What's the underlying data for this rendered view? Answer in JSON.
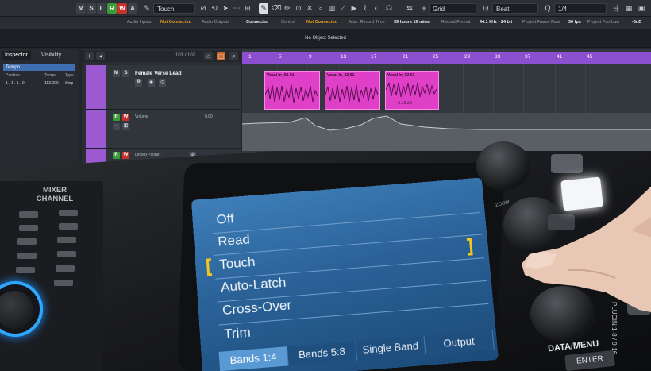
{
  "toolbar": {
    "buttons": [
      "M",
      "S",
      "L",
      "R",
      "W",
      "A"
    ],
    "automation_mode": "Touch",
    "snap_type": "Grid",
    "grid_type": "Beat",
    "quantize": "1/4"
  },
  "infobar": {
    "audio_inputs_label": "Audio Inputs",
    "audio_inputs_value": "Not Connected",
    "audio_outputs_label": "Audio Outputs",
    "audio_outputs_value": "Connected",
    "control_label": "Control",
    "control_value": "Not Connected",
    "max_record_label": "Max. Record Time",
    "max_record_value": "39 hours 16 mins",
    "record_format_label": "Record Format",
    "record_format_value": "44.1 kHz - 24 bit",
    "frame_rate_label": "Project Frame Rate",
    "frame_rate_value": "30 fps",
    "pan_law_label": "Project Pan Law",
    "pan_law_value": "-3dB"
  },
  "status": {
    "text": "No Object Selected"
  },
  "inspector": {
    "tabs": [
      "Inspector",
      "Visibility"
    ],
    "tempo_label": "Tempo",
    "columns": [
      "Position",
      "Tempo",
      "Type"
    ],
    "row": {
      "position": "1 . 1 . 1 . 0",
      "tempo": "113.000",
      "type": "Step"
    }
  },
  "tracklist": {
    "count": "101 / 102",
    "tracks": [
      {
        "name": "Female Verse Lead"
      },
      {
        "param": "Volume",
        "value": "0.00"
      },
      {
        "param": "Linked Panner"
      }
    ]
  },
  "ruler": {
    "bars": [
      "1",
      "5",
      "9",
      "13",
      "17",
      "21",
      "25",
      "29",
      "33",
      "37",
      "41",
      "45"
    ]
  },
  "clips": [
    {
      "name": "Vocal In_02-01"
    },
    {
      "name": "Vocal In_02-01"
    },
    {
      "name": "Vocal In_02-01",
      "gain": "-1.15 dB"
    }
  ],
  "hardware": {
    "mixer_title": "MIXER\nCHANNEL",
    "zoom_label": "ZOOM",
    "data_menu_label": "DATA/MENU",
    "enter_label": "ENTER",
    "plugin_label": "PLUGIN 1-8 / 9-16"
  },
  "screen": {
    "modes": [
      "Off",
      "Read",
      "Touch",
      "Auto-Latch",
      "Cross-Over",
      "Trim"
    ],
    "selected_mode": "Touch",
    "tabs": [
      "Bands 1:4",
      "Bands 5:8",
      "Single Band",
      "Output"
    ],
    "active_tab": "Bands 1:4"
  }
}
